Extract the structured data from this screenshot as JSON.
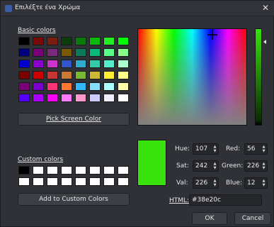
{
  "title": "Επιλέξτε ένα Χρώμα",
  "basic_colors_label": "Basic colors",
  "basic_colors": [
    "#000000",
    "#7a0a0a",
    "#7a1f10",
    "#0b3d0b",
    "#0b7a0b",
    "#0bb80b",
    "#22ee22",
    "#00ff00",
    "#00007a",
    "#7a007a",
    "#7a2a7a",
    "#7a5a00",
    "#0b7a5a",
    "#0bb87a",
    "#55ff88",
    "#88ff88",
    "#0000cc",
    "#8a00cc",
    "#cc33cc",
    "#3355cc",
    "#33aacc",
    "#33ccaa",
    "#55eecc",
    "#aaffcc",
    "#7a0000",
    "#cc0000",
    "#cc3333",
    "#cc7a33",
    "#7ab833",
    "#ccb833",
    "#ffee33",
    "#ffff88",
    "#7a007a",
    "#7a00cc",
    "#ff3377",
    "#ff7733",
    "#33b8ff",
    "#88ddff",
    "#aaffff",
    "#ffffaa",
    "#5500ff",
    "#aa00ff",
    "#ff00ff",
    "#ff7aff",
    "#ff99cc",
    "#ccccff",
    "#eeeeff",
    "#ffffff"
  ],
  "pick_screen_label": "Pick Screen Color",
  "custom_colors_label": "Custom colors",
  "custom_colors": [
    "#000000",
    "#ffffff",
    "#ffffff",
    "#ffffff",
    "#ffffff",
    "#ffffff",
    "#ffffff",
    "#ffffff",
    "#ffffff",
    "#ffffff",
    "#ffffff",
    "#ffffff",
    "#ffffff",
    "#ffffff",
    "#ffffff",
    "#ffffff"
  ],
  "add_custom_label": "Add to Custom Colors",
  "fields": {
    "hue_label": "Hue:",
    "hue": "107",
    "sat_label": "Sat:",
    "sat": "242",
    "val_label": "Val:",
    "val": "226",
    "red_label": "Red:",
    "red": "56",
    "green_label": "Green:",
    "green": "226",
    "blue_label": "Blue:",
    "blue": "12"
  },
  "html_label": "HTML:",
  "html_value": "#38e20c",
  "ok_label": "OK",
  "cancel_label": "Cancel",
  "current_color": "#38e20c"
}
